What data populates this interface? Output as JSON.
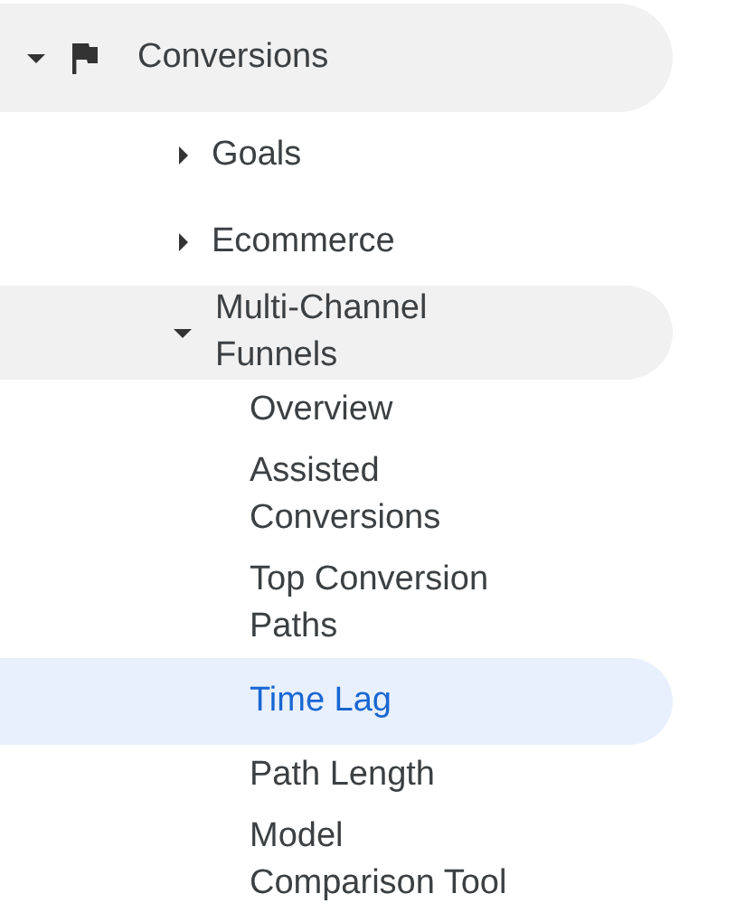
{
  "nav": [
    {
      "label": "Conversions",
      "expanded": true,
      "children": [
        {
          "label": "Goals",
          "expanded": false
        },
        {
          "label": "Ecommerce",
          "expanded": false
        },
        {
          "label": "Multi-Channel Funnels",
          "expanded": true,
          "children": [
            {
              "label": "Overview",
              "selected": false
            },
            {
              "label": "Assisted Conversions",
              "selected": false
            },
            {
              "label": "Top Conversion Paths",
              "selected": false
            },
            {
              "label": "Time Lag",
              "selected": true
            },
            {
              "label": "Path Length",
              "selected": false
            },
            {
              "label": "Model Comparison Tool",
              "selected": false
            }
          ]
        }
      ]
    }
  ]
}
